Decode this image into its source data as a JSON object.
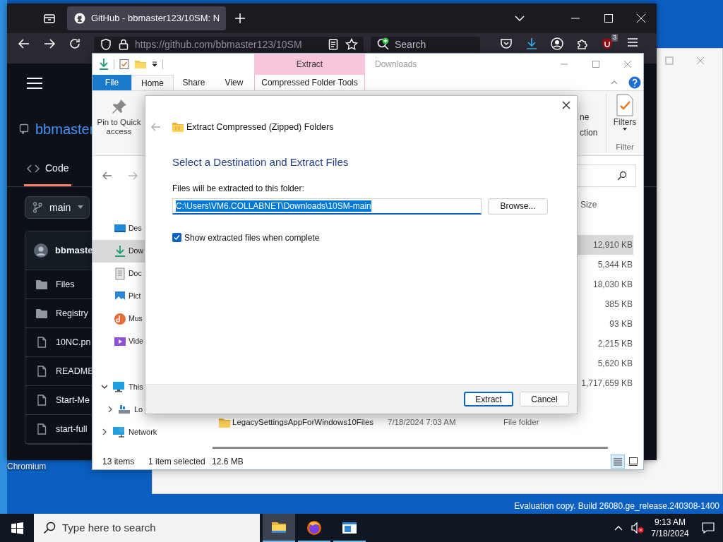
{
  "browser": {
    "tab": {
      "title": "GitHub - bbmaster123/10SM: N",
      "selected": true
    },
    "url": "https://github.com/bbmaster123/10SM",
    "search": {
      "placeholder": "Search"
    },
    "extension_badge": "3",
    "page": {
      "repo": "bbmaster",
      "tabs": [
        {
          "label": "Code",
          "selected": true
        }
      ],
      "branch": "main",
      "commit_author": "bbmaste",
      "files": [
        {
          "kind": "folder",
          "name": "Files"
        },
        {
          "kind": "folder",
          "name": "Registry"
        },
        {
          "kind": "file",
          "name": "10NC.pn"
        },
        {
          "kind": "file",
          "name": "README"
        },
        {
          "kind": "file",
          "name": "Start-Me"
        },
        {
          "kind": "file",
          "name": "start-full"
        }
      ]
    }
  },
  "desktop_icons": [
    {
      "label": "Chromium"
    }
  ],
  "explorer": {
    "context_header": "Extract",
    "title": "Downloads",
    "tabs": [
      {
        "label": "File",
        "kind": "menu",
        "selected": false
      },
      {
        "label": "Home",
        "kind": "tab",
        "selected": true
      },
      {
        "label": "Share",
        "kind": "tab",
        "selected": false
      },
      {
        "label": "View",
        "kind": "tab",
        "selected": false
      },
      {
        "label": "Compressed Folder Tools",
        "kind": "tool",
        "selected": false
      }
    ],
    "ribbon": {
      "pin": "Pin to Quick access",
      "cut_labels": [
        "ne",
        "ction"
      ],
      "filters": "Filters",
      "group": "Filter"
    },
    "nav": [
      {
        "label": "Des",
        "kind": "desktop",
        "selected": false
      },
      {
        "label": "Dow",
        "kind": "downloads",
        "selected": true
      },
      {
        "label": "Doc",
        "kind": "documents",
        "selected": false
      },
      {
        "label": "Pict",
        "kind": "pictures",
        "selected": false
      },
      {
        "label": "Mus",
        "kind": "music",
        "selected": false
      },
      {
        "label": "Vide",
        "kind": "videos",
        "selected": false
      }
    ],
    "tree": [
      {
        "label": "This",
        "kind": "pc",
        "expanded": true,
        "children": [
          {
            "label": "Lo",
            "kind": "drive",
            "expanded": false
          }
        ]
      },
      {
        "label": "Network",
        "kind": "network",
        "expanded": false
      }
    ],
    "size_header": "Size",
    "rows": [
      {
        "size": "12,910 KB",
        "selected": true
      },
      {
        "size": "5,344 KB",
        "selected": false
      },
      {
        "size": "18,030 KB",
        "selected": false
      },
      {
        "size": "385 KB",
        "selected": false
      },
      {
        "size": "93 KB",
        "selected": false
      },
      {
        "size": "2,215 KB",
        "selected": false
      },
      {
        "size": "5,620 KB",
        "selected": false
      },
      {
        "size": "1,717,659 KB",
        "selected": false
      }
    ],
    "folder_row": {
      "name": "LegacySettingsAppForWindows10Files",
      "date": "7/18/2024 7:03 AM",
      "type": "File folder"
    },
    "status": [
      "13 items",
      "1 item selected",
      "12.6 MB"
    ],
    "views": [
      {
        "kind": "details",
        "selected": true
      },
      {
        "kind": "tiles",
        "selected": false
      }
    ]
  },
  "dialog": {
    "title": "Extract Compressed (Zipped) Folders",
    "heading": "Select a Destination and Extract Files",
    "label": "Files will be extracted to this folder:",
    "path": "C:\\Users\\VM6.COLLABNET\\Downloads\\10SM-main",
    "browse": "Browse...",
    "checkbox": {
      "label": "Show extracted files when complete",
      "checked": true
    },
    "buttons": [
      {
        "label": "Extract",
        "default": true
      },
      {
        "label": "Cancel",
        "default": false
      }
    ]
  },
  "watermark": "Evaluation copy. Build 26080.ge_release.240308-1400",
  "taskbar": {
    "search_placeholder": "Type here to search",
    "apps": [
      {
        "kind": "explorer",
        "selected": true
      },
      {
        "kind": "firefox",
        "selected": false
      },
      {
        "kind": "notepad",
        "selected": false
      }
    ],
    "time": "9:13 AM",
    "date": "7/18/2024"
  }
}
